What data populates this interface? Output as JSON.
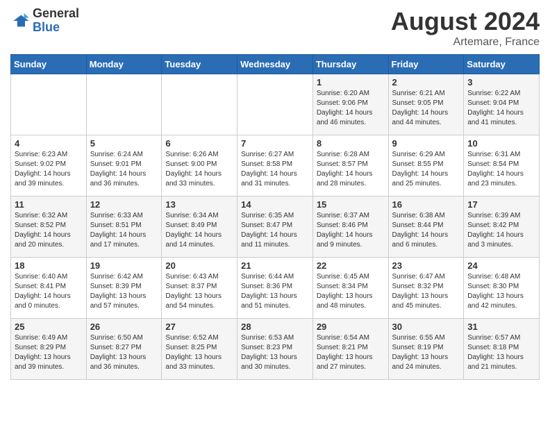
{
  "header": {
    "logo_line1": "General",
    "logo_line2": "Blue",
    "month": "August 2024",
    "location": "Artemare, France"
  },
  "weekdays": [
    "Sunday",
    "Monday",
    "Tuesday",
    "Wednesday",
    "Thursday",
    "Friday",
    "Saturday"
  ],
  "weeks": [
    [
      {
        "day": "",
        "info": ""
      },
      {
        "day": "",
        "info": ""
      },
      {
        "day": "",
        "info": ""
      },
      {
        "day": "",
        "info": ""
      },
      {
        "day": "1",
        "info": "Sunrise: 6:20 AM\nSunset: 9:06 PM\nDaylight: 14 hours and 46 minutes."
      },
      {
        "day": "2",
        "info": "Sunrise: 6:21 AM\nSunset: 9:05 PM\nDaylight: 14 hours and 44 minutes."
      },
      {
        "day": "3",
        "info": "Sunrise: 6:22 AM\nSunset: 9:04 PM\nDaylight: 14 hours and 41 minutes."
      }
    ],
    [
      {
        "day": "4",
        "info": "Sunrise: 6:23 AM\nSunset: 9:02 PM\nDaylight: 14 hours and 39 minutes."
      },
      {
        "day": "5",
        "info": "Sunrise: 6:24 AM\nSunset: 9:01 PM\nDaylight: 14 hours and 36 minutes."
      },
      {
        "day": "6",
        "info": "Sunrise: 6:26 AM\nSunset: 9:00 PM\nDaylight: 14 hours and 33 minutes."
      },
      {
        "day": "7",
        "info": "Sunrise: 6:27 AM\nSunset: 8:58 PM\nDaylight: 14 hours and 31 minutes."
      },
      {
        "day": "8",
        "info": "Sunrise: 6:28 AM\nSunset: 8:57 PM\nDaylight: 14 hours and 28 minutes."
      },
      {
        "day": "9",
        "info": "Sunrise: 6:29 AM\nSunset: 8:55 PM\nDaylight: 14 hours and 25 minutes."
      },
      {
        "day": "10",
        "info": "Sunrise: 6:31 AM\nSunset: 8:54 PM\nDaylight: 14 hours and 23 minutes."
      }
    ],
    [
      {
        "day": "11",
        "info": "Sunrise: 6:32 AM\nSunset: 8:52 PM\nDaylight: 14 hours and 20 minutes."
      },
      {
        "day": "12",
        "info": "Sunrise: 6:33 AM\nSunset: 8:51 PM\nDaylight: 14 hours and 17 minutes."
      },
      {
        "day": "13",
        "info": "Sunrise: 6:34 AM\nSunset: 8:49 PM\nDaylight: 14 hours and 14 minutes."
      },
      {
        "day": "14",
        "info": "Sunrise: 6:35 AM\nSunset: 8:47 PM\nDaylight: 14 hours and 11 minutes."
      },
      {
        "day": "15",
        "info": "Sunrise: 6:37 AM\nSunset: 8:46 PM\nDaylight: 14 hours and 9 minutes."
      },
      {
        "day": "16",
        "info": "Sunrise: 6:38 AM\nSunset: 8:44 PM\nDaylight: 14 hours and 6 minutes."
      },
      {
        "day": "17",
        "info": "Sunrise: 6:39 AM\nSunset: 8:42 PM\nDaylight: 14 hours and 3 minutes."
      }
    ],
    [
      {
        "day": "18",
        "info": "Sunrise: 6:40 AM\nSunset: 8:41 PM\nDaylight: 14 hours and 0 minutes."
      },
      {
        "day": "19",
        "info": "Sunrise: 6:42 AM\nSunset: 8:39 PM\nDaylight: 13 hours and 57 minutes."
      },
      {
        "day": "20",
        "info": "Sunrise: 6:43 AM\nSunset: 8:37 PM\nDaylight: 13 hours and 54 minutes."
      },
      {
        "day": "21",
        "info": "Sunrise: 6:44 AM\nSunset: 8:36 PM\nDaylight: 13 hours and 51 minutes."
      },
      {
        "day": "22",
        "info": "Sunrise: 6:45 AM\nSunset: 8:34 PM\nDaylight: 13 hours and 48 minutes."
      },
      {
        "day": "23",
        "info": "Sunrise: 6:47 AM\nSunset: 8:32 PM\nDaylight: 13 hours and 45 minutes."
      },
      {
        "day": "24",
        "info": "Sunrise: 6:48 AM\nSunset: 8:30 PM\nDaylight: 13 hours and 42 minutes."
      }
    ],
    [
      {
        "day": "25",
        "info": "Sunrise: 6:49 AM\nSunset: 8:29 PM\nDaylight: 13 hours and 39 minutes."
      },
      {
        "day": "26",
        "info": "Sunrise: 6:50 AM\nSunset: 8:27 PM\nDaylight: 13 hours and 36 minutes."
      },
      {
        "day": "27",
        "info": "Sunrise: 6:52 AM\nSunset: 8:25 PM\nDaylight: 13 hours and 33 minutes."
      },
      {
        "day": "28",
        "info": "Sunrise: 6:53 AM\nSunset: 8:23 PM\nDaylight: 13 hours and 30 minutes."
      },
      {
        "day": "29",
        "info": "Sunrise: 6:54 AM\nSunset: 8:21 PM\nDaylight: 13 hours and 27 minutes."
      },
      {
        "day": "30",
        "info": "Sunrise: 6:55 AM\nSunset: 8:19 PM\nDaylight: 13 hours and 24 minutes."
      },
      {
        "day": "31",
        "info": "Sunrise: 6:57 AM\nSunset: 8:18 PM\nDaylight: 13 hours and 21 minutes."
      }
    ]
  ]
}
